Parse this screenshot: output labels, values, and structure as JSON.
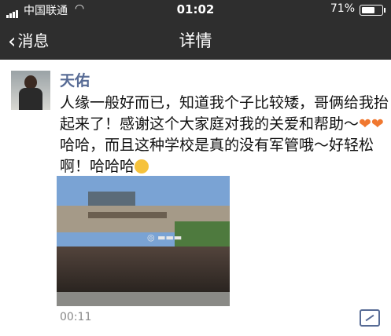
{
  "status_bar": {
    "carrier": "中国联通",
    "time": "01:02",
    "battery_percent": "71%",
    "battery_level": 0.71
  },
  "nav": {
    "back_label": "消息",
    "title": "详情"
  },
  "post": {
    "username": "天佑",
    "text_part1": "人缘一般好而已，知道我个子比较矮，哥俩给我抬起来了！感谢这个大家庭对我的关爱和帮助～",
    "emoji_hearts": "❤❤",
    "text_part2": "哈哈，而且这种学校是真的没有军管哦～好轻松啊！哈哈哈",
    "video_duration": "00:11"
  },
  "colors": {
    "username": "#576b95",
    "nav_bg": "#2e2e2e"
  }
}
